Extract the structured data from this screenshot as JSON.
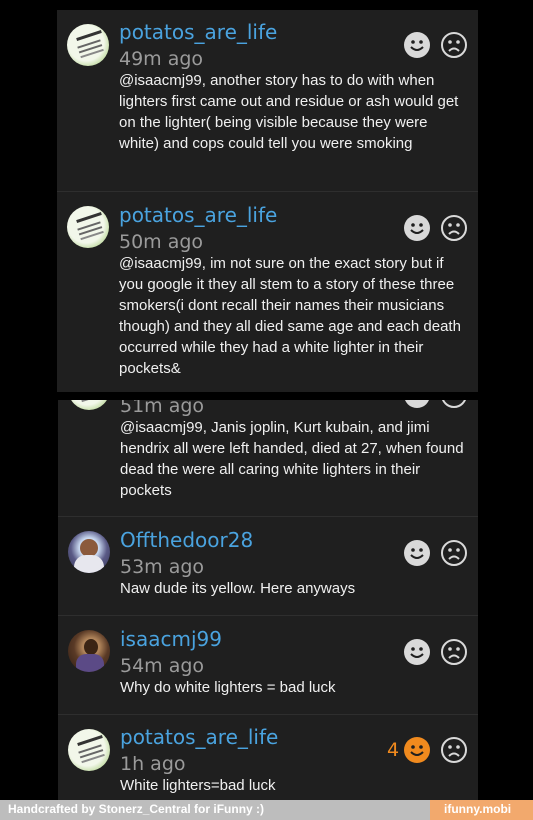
{
  "comments_top": [
    {
      "username": "potatos_are_life",
      "time": "49m ago",
      "text": "@isaacmj99, another story has to do with when lighters first came out and residue or ash would get on the lighter( being visible because they were white) and cops could tell you were smoking"
    },
    {
      "username": "potatos_are_life",
      "time": "50m ago",
      "text": "@isaacmj99, im not sure on the exact story but if you google it they all stem to a story of these three smokers(i dont recall their names their musicians though) and they all died same age and each death occurred while they had a white lighter in their pockets&"
    }
  ],
  "comments_bottom": [
    {
      "time": "51m ago",
      "text": "@isaacmj99, Janis joplin, Kurt kubain, and jimi hendrix all were left handed, died at 27, when found dead the were all caring white lighters in their pockets"
    },
    {
      "username": "Offthedoor28",
      "time": "53m ago",
      "text": "Naw dude its yellow. Here anyways"
    },
    {
      "username": "isaacmj99",
      "time": "54m ago",
      "text": "Why do white lighters = bad luck"
    },
    {
      "username": "potatos_are_life",
      "time": "1h ago",
      "text": "White lighters=bad luck",
      "smile_count": "4"
    }
  ],
  "footer": {
    "credit": "Handcrafted by Stonerz_Central for iFunny :)",
    "brand": "ifunny.mobi"
  },
  "colors": {
    "username": "#4aa3df",
    "accent": "#f08a1e",
    "panel": "#1f1f1f"
  },
  "icons": [
    "smile-icon",
    "frown-icon"
  ]
}
